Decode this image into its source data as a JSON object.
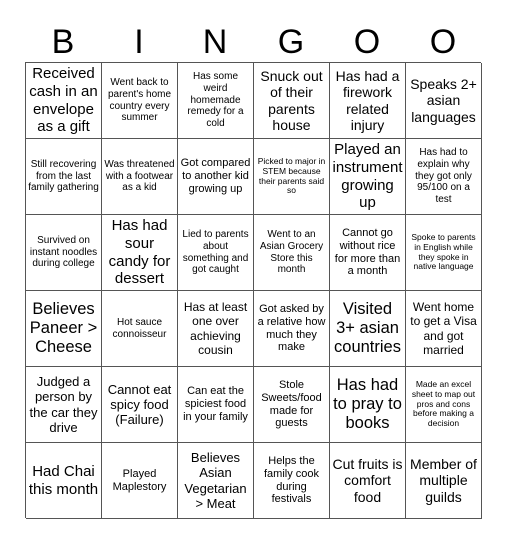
{
  "header": {
    "letters": [
      "B",
      "I",
      "N",
      "G",
      "O",
      "O"
    ]
  },
  "board": {
    "rows": [
      [
        "Received cash in an envelope as a gift",
        "Went back to parent's home country every summer",
        "Has some weird homemade remedy for a cold",
        "Snuck out of their parents house",
        "Has had a firework related injury",
        "Speaks 2+ asian languages"
      ],
      [
        "Still recovering from the last family gathering",
        "Was threatened with a footwear as a kid",
        "Got compared to another kid growing up",
        "Picked to major in STEM because their parents said so",
        "Played an instrument growing up",
        "Has had to explain why they got only 95/100 on a test"
      ],
      [
        "Survived on instant noodles during college",
        "Has had sour candy for dessert",
        "Lied to parents about something and got caught",
        "Went to an Asian Grocery Store this month",
        "Cannot go without rice for more than a month",
        "Spoke to parents in English while they spoke in native language"
      ],
      [
        "Believes Paneer > Cheese",
        "Hot sauce connoisseur",
        "Has at least one over achieving cousin",
        "Got asked by a relative how much they make",
        "Visited 3+ asian countries",
        "Went home to get a Visa and got married"
      ],
      [
        "Judged a person by the car they drive",
        "Cannot eat spicy food (Failure)",
        "Can eat the spiciest food in your family",
        "Stole Sweets/food made for guests",
        "Has had to pray to books",
        "Made an excel sheet to map out pros and cons before making a decision"
      ],
      [
        "Had Chai this month",
        "Played Maplestory",
        "Believes Asian Vegetarian > Meat",
        "Helps the family cook during festivals",
        "Cut fruits is comfort food",
        "Member of multiple guilds"
      ]
    ]
  }
}
